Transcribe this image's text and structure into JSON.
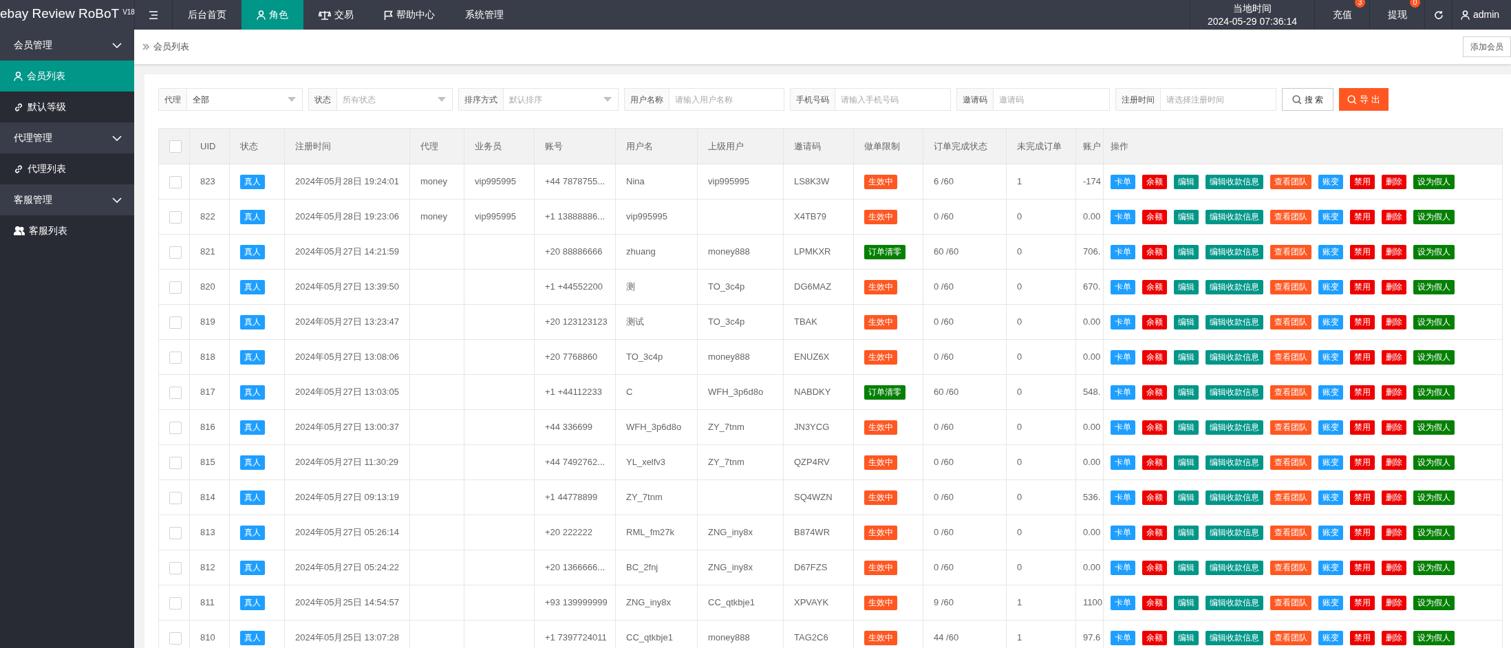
{
  "brand": {
    "name": "ebay Review RoBoT",
    "version": "V18"
  },
  "top_nav": [
    {
      "kind": "menu",
      "selected": false
    },
    {
      "label": "后台首页",
      "kind": "text",
      "selected": false
    },
    {
      "label": "角色",
      "kind": "user",
      "selected": true
    },
    {
      "label": "交易",
      "kind": "scale",
      "selected": false
    },
    {
      "label": "帮助中心",
      "kind": "flag",
      "selected": false
    },
    {
      "label": "系统管理",
      "kind": "text",
      "selected": false
    }
  ],
  "clock": {
    "label": "当地时间",
    "time": "2024-05-29 07:36:14"
  },
  "top_actions": [
    {
      "label": "充值",
      "badge": "3"
    },
    {
      "label": "提现",
      "badge": "0"
    }
  ],
  "user": {
    "name": "admin"
  },
  "sidebar": [
    {
      "label": "会员管理",
      "expanded": true,
      "children": [
        {
          "label": "会员列表",
          "kind": "user",
          "selected": true
        },
        {
          "label": "默认等级",
          "kind": "link",
          "selected": false
        }
      ]
    },
    {
      "label": "代理管理",
      "expanded": true,
      "children": [
        {
          "label": "代理列表",
          "kind": "link",
          "selected": false
        }
      ]
    },
    {
      "label": "客服管理",
      "expanded": true,
      "children": [
        {
          "label": "客服列表",
          "kind": "users",
          "selected": false
        }
      ]
    }
  ],
  "breadcrumb": "会员列表",
  "add_button": "添加会员",
  "filters": [
    {
      "label": "代理",
      "kind": "select",
      "value": "全部"
    },
    {
      "label": "状态",
      "kind": "select",
      "placeholder": "所有状态"
    },
    {
      "label": "排序方式",
      "kind": "select",
      "placeholder": "默认排序"
    },
    {
      "label": "用户名称",
      "kind": "input",
      "placeholder": "请输入用户名称"
    },
    {
      "label": "手机号码",
      "kind": "input",
      "placeholder": "请输入手机号码"
    },
    {
      "label": "邀请码",
      "kind": "input",
      "placeholder": "邀请码"
    },
    {
      "label": "注册时间",
      "kind": "input",
      "placeholder": "请选择注册时间"
    }
  ],
  "search_button": "搜 索",
  "export_button": "导 出",
  "table": {
    "select_all_checked": false,
    "columns": [
      "UID",
      "状态",
      "注册时间",
      "代理",
      "业务员",
      "账号",
      "用户名",
      "上级用户",
      "邀请码",
      "做单限制",
      "订单完成状态",
      "未完成订单",
      "账户",
      "操作"
    ],
    "rows": [
      {
        "checked": false,
        "uid": "823",
        "status": "真人",
        "registered": "2024年05月28日 19:24:01",
        "agent": "money",
        "salesman": "vip995995",
        "account": "+44 7878755...",
        "username": "Nina",
        "parent": "vip995995",
        "invite_code": "LS8K3W",
        "limit": {
          "text": "生效中",
          "kind": "active"
        },
        "progress": "6 /60",
        "pending": "1",
        "balance": "-174",
        "actions": [
          {
            "label": "卡单",
            "color": "#1e9fff"
          },
          {
            "label": "余额",
            "color": "#ee0000"
          },
          {
            "label": "编辑",
            "color": "#009688"
          },
          {
            "label": "编辑收款信息",
            "color": "#009688"
          },
          {
            "label": "查看团队",
            "color": "#ff5722"
          },
          {
            "label": "账变",
            "color": "#1e9fff"
          },
          {
            "label": "禁用",
            "color": "#ee0000"
          },
          {
            "label": "删除",
            "color": "#ee0000"
          },
          {
            "label": "设为假人",
            "color": "#058005"
          }
        ]
      },
      {
        "checked": false,
        "uid": "822",
        "status": "真人",
        "registered": "2024年05月28日 19:23:06",
        "agent": "money",
        "salesman": "vip995995",
        "account": "+1 13888886...",
        "username": "vip995995",
        "parent": "",
        "invite_code": "X4TB79",
        "limit": {
          "text": "生效中",
          "kind": "active"
        },
        "progress": "0 /60",
        "pending": "0",
        "balance": "0.00",
        "actions": [
          {
            "label": "卡单",
            "color": "#1e9fff"
          },
          {
            "label": "余额",
            "color": "#ee0000"
          },
          {
            "label": "编辑",
            "color": "#009688"
          },
          {
            "label": "编辑收款信息",
            "color": "#009688"
          },
          {
            "label": "查看团队",
            "color": "#ff5722"
          },
          {
            "label": "账变",
            "color": "#1e9fff"
          },
          {
            "label": "禁用",
            "color": "#ee0000"
          },
          {
            "label": "删除",
            "color": "#ee0000"
          },
          {
            "label": "设为假人",
            "color": "#058005"
          }
        ]
      },
      {
        "checked": false,
        "uid": "821",
        "status": "真人",
        "registered": "2024年05月27日 14:21:59",
        "agent": "",
        "salesman": "",
        "account": "+20 88886666",
        "username": "zhuang",
        "parent": "money888",
        "invite_code": "LPMKXR",
        "limit": {
          "text": "订单清零",
          "kind": "cleared"
        },
        "progress": "60 /60",
        "pending": "0",
        "balance": "706.",
        "actions": [
          {
            "label": "卡单",
            "color": "#1e9fff"
          },
          {
            "label": "余额",
            "color": "#ee0000"
          },
          {
            "label": "编辑",
            "color": "#009688"
          },
          {
            "label": "编辑收款信息",
            "color": "#009688"
          },
          {
            "label": "查看团队",
            "color": "#ff5722"
          },
          {
            "label": "账变",
            "color": "#1e9fff"
          },
          {
            "label": "禁用",
            "color": "#ee0000"
          },
          {
            "label": "删除",
            "color": "#ee0000"
          },
          {
            "label": "设为假人",
            "color": "#058005"
          }
        ]
      },
      {
        "checked": false,
        "uid": "820",
        "status": "真人",
        "registered": "2024年05月27日 13:39:50",
        "agent": "",
        "salesman": "",
        "account": "+1 +44552200",
        "username": "测",
        "parent": "TO_3c4p",
        "invite_code": "DG6MAZ",
        "limit": {
          "text": "生效中",
          "kind": "active"
        },
        "progress": "0 /60",
        "pending": "0",
        "balance": "670.",
        "actions": [
          {
            "label": "卡单",
            "color": "#1e9fff"
          },
          {
            "label": "余额",
            "color": "#ee0000"
          },
          {
            "label": "编辑",
            "color": "#009688"
          },
          {
            "label": "编辑收款信息",
            "color": "#009688"
          },
          {
            "label": "查看团队",
            "color": "#ff5722"
          },
          {
            "label": "账变",
            "color": "#1e9fff"
          },
          {
            "label": "禁用",
            "color": "#ee0000"
          },
          {
            "label": "删除",
            "color": "#ee0000"
          },
          {
            "label": "设为假人",
            "color": "#058005"
          }
        ]
      },
      {
        "checked": false,
        "uid": "819",
        "status": "真人",
        "registered": "2024年05月27日 13:23:47",
        "agent": "",
        "salesman": "",
        "account": "+20 123123123",
        "username": "测试",
        "parent": "TO_3c4p",
        "invite_code": "TBAK",
        "limit": {
          "text": "生效中",
          "kind": "active"
        },
        "progress": "0 /60",
        "pending": "0",
        "balance": "0.00",
        "actions": [
          {
            "label": "卡单",
            "color": "#1e9fff"
          },
          {
            "label": "余额",
            "color": "#ee0000"
          },
          {
            "label": "编辑",
            "color": "#009688"
          },
          {
            "label": "编辑收款信息",
            "color": "#009688"
          },
          {
            "label": "查看团队",
            "color": "#ff5722"
          },
          {
            "label": "账变",
            "color": "#1e9fff"
          },
          {
            "label": "禁用",
            "color": "#ee0000"
          },
          {
            "label": "删除",
            "color": "#ee0000"
          },
          {
            "label": "设为假人",
            "color": "#058005"
          }
        ]
      },
      {
        "checked": false,
        "uid": "818",
        "status": "真人",
        "registered": "2024年05月27日 13:08:06",
        "agent": "",
        "salesman": "",
        "account": "+20 7768860",
        "username": "TO_3c4p",
        "parent": "money888",
        "invite_code": "ENUZ6X",
        "limit": {
          "text": "生效中",
          "kind": "active"
        },
        "progress": "0 /60",
        "pending": "0",
        "balance": "0.00",
        "actions": [
          {
            "label": "卡单",
            "color": "#1e9fff"
          },
          {
            "label": "余额",
            "color": "#ee0000"
          },
          {
            "label": "编辑",
            "color": "#009688"
          },
          {
            "label": "编辑收款信息",
            "color": "#009688"
          },
          {
            "label": "查看团队",
            "color": "#ff5722"
          },
          {
            "label": "账变",
            "color": "#1e9fff"
          },
          {
            "label": "禁用",
            "color": "#ee0000"
          },
          {
            "label": "删除",
            "color": "#ee0000"
          },
          {
            "label": "设为假人",
            "color": "#058005"
          }
        ]
      },
      {
        "checked": false,
        "uid": "817",
        "status": "真人",
        "registered": "2024年05月27日 13:03:05",
        "agent": "",
        "salesman": "",
        "account": "+1 +44112233",
        "username": "C",
        "parent": "WFH_3p6d8o",
        "invite_code": "NABDKY",
        "limit": {
          "text": "订单清零",
          "kind": "cleared"
        },
        "progress": "60 /60",
        "pending": "0",
        "balance": "548.",
        "actions": [
          {
            "label": "卡单",
            "color": "#1e9fff"
          },
          {
            "label": "余额",
            "color": "#ee0000"
          },
          {
            "label": "编辑",
            "color": "#009688"
          },
          {
            "label": "编辑收款信息",
            "color": "#009688"
          },
          {
            "label": "查看团队",
            "color": "#ff5722"
          },
          {
            "label": "账变",
            "color": "#1e9fff"
          },
          {
            "label": "禁用",
            "color": "#ee0000"
          },
          {
            "label": "删除",
            "color": "#ee0000"
          },
          {
            "label": "设为假人",
            "color": "#058005"
          }
        ]
      },
      {
        "checked": false,
        "uid": "816",
        "status": "真人",
        "registered": "2024年05月27日 13:00:37",
        "agent": "",
        "salesman": "",
        "account": "+44 336699",
        "username": "WFH_3p6d8o",
        "parent": "ZY_7tnm",
        "invite_code": "JN3YCG",
        "limit": {
          "text": "生效中",
          "kind": "active"
        },
        "progress": "0 /60",
        "pending": "0",
        "balance": "0.00",
        "actions": [
          {
            "label": "卡单",
            "color": "#1e9fff"
          },
          {
            "label": "余额",
            "color": "#ee0000"
          },
          {
            "label": "编辑",
            "color": "#009688"
          },
          {
            "label": "编辑收款信息",
            "color": "#009688"
          },
          {
            "label": "查看团队",
            "color": "#ff5722"
          },
          {
            "label": "账变",
            "color": "#1e9fff"
          },
          {
            "label": "禁用",
            "color": "#ee0000"
          },
          {
            "label": "删除",
            "color": "#ee0000"
          },
          {
            "label": "设为假人",
            "color": "#058005"
          }
        ]
      },
      {
        "checked": false,
        "uid": "815",
        "status": "真人",
        "registered": "2024年05月27日 11:30:29",
        "agent": "",
        "salesman": "",
        "account": "+44 7492762...",
        "username": "YL_xelfv3",
        "parent": "ZY_7tnm",
        "invite_code": "QZP4RV",
        "limit": {
          "text": "生效中",
          "kind": "active"
        },
        "progress": "0 /60",
        "pending": "0",
        "balance": "0.00",
        "actions": [
          {
            "label": "卡单",
            "color": "#1e9fff"
          },
          {
            "label": "余额",
            "color": "#ee0000"
          },
          {
            "label": "编辑",
            "color": "#009688"
          },
          {
            "label": "编辑收款信息",
            "color": "#009688"
          },
          {
            "label": "查看团队",
            "color": "#ff5722"
          },
          {
            "label": "账变",
            "color": "#1e9fff"
          },
          {
            "label": "禁用",
            "color": "#ee0000"
          },
          {
            "label": "删除",
            "color": "#ee0000"
          },
          {
            "label": "设为假人",
            "color": "#058005"
          }
        ]
      },
      {
        "checked": false,
        "uid": "814",
        "status": "真人",
        "registered": "2024年05月27日 09:13:19",
        "agent": "",
        "salesman": "",
        "account": "+1 44778899",
        "username": "ZY_7tnm",
        "parent": "",
        "invite_code": "SQ4WZN",
        "limit": {
          "text": "生效中",
          "kind": "active"
        },
        "progress": "0 /60",
        "pending": "0",
        "balance": "536.",
        "actions": [
          {
            "label": "卡单",
            "color": "#1e9fff"
          },
          {
            "label": "余额",
            "color": "#ee0000"
          },
          {
            "label": "编辑",
            "color": "#009688"
          },
          {
            "label": "编辑收款信息",
            "color": "#009688"
          },
          {
            "label": "查看团队",
            "color": "#ff5722"
          },
          {
            "label": "账变",
            "color": "#1e9fff"
          },
          {
            "label": "禁用",
            "color": "#ee0000"
          },
          {
            "label": "删除",
            "color": "#ee0000"
          },
          {
            "label": "设为假人",
            "color": "#058005"
          }
        ]
      },
      {
        "checked": false,
        "uid": "813",
        "status": "真人",
        "registered": "2024年05月27日 05:26:14",
        "agent": "",
        "salesman": "",
        "account": "+20 222222",
        "username": "RML_fm27k",
        "parent": "ZNG_iny8x",
        "invite_code": "B874WR",
        "limit": {
          "text": "生效中",
          "kind": "active"
        },
        "progress": "0 /60",
        "pending": "0",
        "balance": "0.00",
        "actions": [
          {
            "label": "卡单",
            "color": "#1e9fff"
          },
          {
            "label": "余额",
            "color": "#ee0000"
          },
          {
            "label": "编辑",
            "color": "#009688"
          },
          {
            "label": "编辑收款信息",
            "color": "#009688"
          },
          {
            "label": "查看团队",
            "color": "#ff5722"
          },
          {
            "label": "账变",
            "color": "#1e9fff"
          },
          {
            "label": "禁用",
            "color": "#ee0000"
          },
          {
            "label": "删除",
            "color": "#ee0000"
          },
          {
            "label": "设为假人",
            "color": "#058005"
          }
        ]
      },
      {
        "checked": false,
        "uid": "812",
        "status": "真人",
        "registered": "2024年05月27日 05:24:22",
        "agent": "",
        "salesman": "",
        "account": "+20 1366666...",
        "username": "BC_2fnj",
        "parent": "ZNG_iny8x",
        "invite_code": "D67FZS",
        "limit": {
          "text": "生效中",
          "kind": "active"
        },
        "progress": "0 /60",
        "pending": "0",
        "balance": "0.00",
        "actions": [
          {
            "label": "卡单",
            "color": "#1e9fff"
          },
          {
            "label": "余额",
            "color": "#ee0000"
          },
          {
            "label": "编辑",
            "color": "#009688"
          },
          {
            "label": "编辑收款信息",
            "color": "#009688"
          },
          {
            "label": "查看团队",
            "color": "#ff5722"
          },
          {
            "label": "账变",
            "color": "#1e9fff"
          },
          {
            "label": "禁用",
            "color": "#ee0000"
          },
          {
            "label": "删除",
            "color": "#ee0000"
          },
          {
            "label": "设为假人",
            "color": "#058005"
          }
        ]
      },
      {
        "checked": false,
        "uid": "811",
        "status": "真人",
        "registered": "2024年05月25日 14:54:57",
        "agent": "",
        "salesman": "",
        "account": "+93 139999999",
        "username": "ZNG_iny8x",
        "parent": "CC_qtkbje1",
        "invite_code": "XPVAYK",
        "limit": {
          "text": "生效中",
          "kind": "active"
        },
        "progress": "9 /60",
        "pending": "1",
        "balance": "1100",
        "actions": [
          {
            "label": "卡单",
            "color": "#1e9fff"
          },
          {
            "label": "余额",
            "color": "#ee0000"
          },
          {
            "label": "编辑",
            "color": "#009688"
          },
          {
            "label": "编辑收款信息",
            "color": "#009688"
          },
          {
            "label": "查看团队",
            "color": "#ff5722"
          },
          {
            "label": "账变",
            "color": "#1e9fff"
          },
          {
            "label": "禁用",
            "color": "#ee0000"
          },
          {
            "label": "删除",
            "color": "#ee0000"
          },
          {
            "label": "设为假人",
            "color": "#058005"
          }
        ]
      },
      {
        "checked": false,
        "uid": "810",
        "status": "真人",
        "registered": "2024年05月25日 13:07:28",
        "agent": "",
        "salesman": "",
        "account": "+1 7397724011",
        "username": "CC_qtkbje1",
        "parent": "money888",
        "invite_code": "TAG2C6",
        "limit": {
          "text": "生效中",
          "kind": "active"
        },
        "progress": "44 /60",
        "pending": "1",
        "balance": "97.6",
        "actions": [
          {
            "label": "卡单",
            "color": "#1e9fff"
          },
          {
            "label": "余额",
            "color": "#ee0000"
          },
          {
            "label": "编辑",
            "color": "#009688"
          },
          {
            "label": "编辑收款信息",
            "color": "#009688"
          },
          {
            "label": "查看团队",
            "color": "#ff5722"
          },
          {
            "label": "账变",
            "color": "#1e9fff"
          },
          {
            "label": "禁用",
            "color": "#ee0000"
          },
          {
            "label": "删除",
            "color": "#ee0000"
          },
          {
            "label": "设为假人",
            "color": "#058005"
          }
        ]
      }
    ]
  }
}
